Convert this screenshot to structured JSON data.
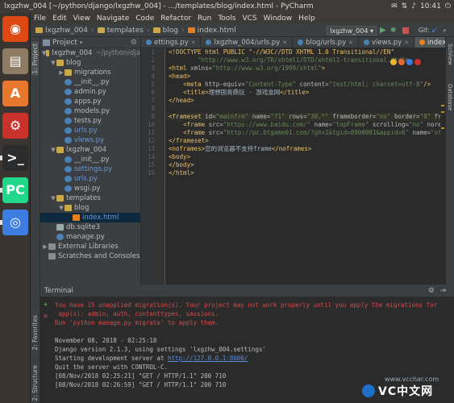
{
  "window": {
    "title": "lxgzhw_004 [~/python/django/lxgzhw_004] - .../templates/blog/index.html - PyCharm",
    "time": "10:41"
  },
  "menu": [
    "File",
    "Edit",
    "View",
    "Navigate",
    "Code",
    "Refactor",
    "Run",
    "Tools",
    "VCS",
    "Window",
    "Help"
  ],
  "nav": {
    "crumbs": [
      "lxgzhw_004",
      "templates",
      "blog",
      "index.html"
    ],
    "run_config": "lxgzhw_004",
    "git_label": "Git:"
  },
  "launcher": [
    {
      "name": "ubuntu-dash",
      "color": "#dd4814",
      "glyph": "◉"
    },
    {
      "name": "files",
      "color": "#8d7b63",
      "glyph": "▤"
    },
    {
      "name": "software-center",
      "color": "#e8772e",
      "glyph": "A"
    },
    {
      "name": "settings",
      "color": "#c8322b",
      "glyph": "⚙"
    },
    {
      "name": "terminal",
      "color": "#2c2c2c",
      "glyph": ">_"
    },
    {
      "name": "pycharm",
      "color": "#21d789",
      "glyph": "PC"
    },
    {
      "name": "chromium",
      "color": "#3d7ce0",
      "glyph": "◎"
    }
  ],
  "project": {
    "header": "Project",
    "tab_label": "1: Project",
    "tree": [
      {
        "label": "lxgzhw_004",
        "suffix": "~/python/dja",
        "indent": 0,
        "type": "folder",
        "arrow": "▼"
      },
      {
        "label": "blog",
        "indent": 1,
        "type": "folder",
        "arrow": "▼"
      },
      {
        "label": "migrations",
        "indent": 2,
        "type": "folder",
        "arrow": "▶"
      },
      {
        "label": "__init__.py",
        "indent": 2,
        "type": "py",
        "arrow": ""
      },
      {
        "label": "admin.py",
        "indent": 2,
        "type": "py",
        "arrow": ""
      },
      {
        "label": "apps.py",
        "indent": 2,
        "type": "py",
        "arrow": ""
      },
      {
        "label": "models.py",
        "indent": 2,
        "type": "py",
        "arrow": ""
      },
      {
        "label": "tests.py",
        "indent": 2,
        "type": "py",
        "arrow": ""
      },
      {
        "label": "urls.py",
        "indent": 2,
        "type": "py",
        "arrow": ""
      },
      {
        "label": "views.py",
        "indent": 2,
        "type": "py",
        "arrow": ""
      },
      {
        "label": "lxgzhw_004",
        "indent": 1,
        "type": "folder",
        "arrow": "▼"
      },
      {
        "label": "__init__.py",
        "indent": 2,
        "type": "py",
        "arrow": ""
      },
      {
        "label": "settings.py",
        "indent": 2,
        "type": "py",
        "arrow": ""
      },
      {
        "label": "urls.py",
        "indent": 2,
        "type": "py",
        "arrow": ""
      },
      {
        "label": "wsgi.py",
        "indent": 2,
        "type": "py",
        "arrow": ""
      },
      {
        "label": "templates",
        "indent": 1,
        "type": "folder",
        "arrow": "▼"
      },
      {
        "label": "blog",
        "indent": 2,
        "type": "folder",
        "arrow": "▼"
      },
      {
        "label": "index.html",
        "indent": 3,
        "type": "html",
        "arrow": "",
        "selected": true
      },
      {
        "label": "db.sqlite3",
        "indent": 1,
        "type": "db",
        "arrow": ""
      },
      {
        "label": "manage.py",
        "indent": 1,
        "type": "py",
        "arrow": ""
      },
      {
        "label": "External Libraries",
        "indent": 0,
        "type": "lib",
        "arrow": "▶"
      },
      {
        "label": "Scratches and Consoles",
        "indent": 0,
        "type": "lib",
        "arrow": ""
      }
    ]
  },
  "tabs": [
    {
      "label": "ettings.py",
      "color": "#4a82b5",
      "active": false
    },
    {
      "label": "lxgzhw_004/urls.py",
      "color": "#4a82b5",
      "active": false
    },
    {
      "label": "blog/urls.py",
      "color": "#4a82b5",
      "active": false
    },
    {
      "label": "views.py",
      "color": "#4a82b5",
      "active": false
    },
    {
      "label": "index.html",
      "color": "#e67e22",
      "active": true
    }
  ],
  "editor": {
    "line_numbers": [
      "1",
      "2",
      "3",
      "4",
      "5",
      "6",
      "7",
      "8",
      "9",
      "10",
      "11",
      "12",
      "13",
      "14",
      "15",
      "16"
    ],
    "lines": [
      [
        {
          "c": "tg",
          "t": "<!DOCTYPE html PUBLIC \"-//W3C//DTD XHTML 1.0 Transitional//EN\""
        }
      ],
      [
        {
          "c": "st",
          "t": "        \"http://www.w3.org/TR/xhtml1/DTD/xhtml1-transitional.dtd\""
        },
        {
          "c": "tg",
          "t": ">"
        }
      ],
      [
        {
          "c": "tg",
          "t": "<html "
        },
        {
          "c": "at",
          "t": "xmlns="
        },
        {
          "c": "st",
          "t": "\"http://www.w3.org/1999/xhtml\""
        },
        {
          "c": "tg",
          "t": ">"
        }
      ],
      [
        {
          "c": "tg",
          "t": "<head>"
        }
      ],
      [
        {
          "c": "tx",
          "t": "    "
        },
        {
          "c": "tg",
          "t": "<meta "
        },
        {
          "c": "at",
          "t": "http-equiv="
        },
        {
          "c": "st",
          "t": "\"Content-Type\""
        },
        {
          "c": "at",
          "t": " content="
        },
        {
          "c": "st",
          "t": "\"text/html; charset=utf-8\""
        },
        {
          "c": "tg",
          "t": "/>"
        }
      ],
      [
        {
          "c": "tx",
          "t": "    "
        },
        {
          "c": "tg",
          "t": "<title>"
        },
        {
          "c": "tx",
          "t": "理想国青鼎玩 · 游戏盒网"
        },
        {
          "c": "tg",
          "t": "</title>"
        }
      ],
      [
        {
          "c": "tg",
          "t": "</head>"
        }
      ],
      [
        {
          "c": "tx",
          "t": ""
        }
      ],
      [
        {
          "c": "tg",
          "t": "<frameset "
        },
        {
          "c": "at",
          "t": "id="
        },
        {
          "c": "st",
          "t": "\"mainfrm\""
        },
        {
          "c": "at",
          "t": " name="
        },
        {
          "c": "st",
          "t": "\"f1\""
        },
        {
          "c": "at",
          "t": " rows="
        },
        {
          "c": "st",
          "t": "\"30,*\""
        },
        {
          "c": "at",
          "t": " frameborder="
        },
        {
          "c": "st",
          "t": "\"no\""
        },
        {
          "c": "at",
          "t": " border="
        },
        {
          "c": "st",
          "t": "\"0\""
        },
        {
          "c": "at",
          "t": " fra"
        }
      ],
      [
        {
          "c": "tx",
          "t": "    "
        },
        {
          "c": "tg",
          "t": "<frame "
        },
        {
          "c": "at",
          "t": "src="
        },
        {
          "c": "st",
          "t": "\"https://www.baidu.com/\""
        },
        {
          "c": "at",
          "t": " name="
        },
        {
          "c": "st",
          "t": "\"topFrame\""
        },
        {
          "c": "at",
          "t": " scrolling="
        },
        {
          "c": "st",
          "t": "\"no\""
        },
        {
          "c": "at",
          "t": " nores"
        }
      ],
      [
        {
          "c": "tx",
          "t": "    "
        },
        {
          "c": "tg",
          "t": "<frame "
        },
        {
          "c": "at",
          "t": "src="
        },
        {
          "c": "st",
          "t": "\"http://pc.btgame01.com/?gh=1&tgid=8900001&appid=6\""
        },
        {
          "c": "at",
          "t": " name="
        },
        {
          "c": "st",
          "t": "\"ot"
        }
      ],
      [
        {
          "c": "tg",
          "t": "</frameset>"
        }
      ],
      [
        {
          "c": "tg",
          "t": "<noframes>"
        },
        {
          "c": "tx",
          "t": "您的浏览器不支持frame"
        },
        {
          "c": "tg",
          "t": "</noframes>"
        }
      ],
      [
        {
          "c": "tg",
          "t": "<body>"
        }
      ],
      [
        {
          "c": "tg",
          "t": "</body>"
        }
      ],
      [
        {
          "c": "tg",
          "t": "</html>"
        }
      ]
    ]
  },
  "right_tools": [
    "SciView",
    "Database"
  ],
  "terminal": {
    "title": "Terminal",
    "lines": [
      {
        "red": true,
        "t": "You have 15 unapplied migration(s). Your project may not work properly until you apply the migrations for"
      },
      {
        "red": true,
        "t": " app(s): admin, auth, contenttypes, sessions."
      },
      {
        "red": true,
        "t": "Run 'python manage.py migrate' to apply them."
      },
      {
        "red": false,
        "t": ""
      },
      {
        "red": false,
        "t": "November 08, 2018 - 02:25:18"
      },
      {
        "red": false,
        "t": "Django version 2.1.3, using settings 'lxgzhw_004.settings'"
      },
      {
        "red": false,
        "t": "Starting development server at ",
        "link": "http://127.0.0.1:8000/"
      },
      {
        "red": false,
        "t": "Quit the server with CONTROL-C."
      },
      {
        "red": false,
        "t": "[08/Nov/2018 02:25:21] \"GET / HTTP/1.1\" 200 710"
      },
      {
        "red": false,
        "t": "[08/Nov/2018 02:26:59] \"GET / HTTP/1.1\" 200 710"
      }
    ]
  },
  "bottom_tools": [
    "2: Favorites",
    "2: Structure"
  ],
  "watermark": {
    "url": "www.vcchar.com",
    "text": "VC中文网"
  }
}
